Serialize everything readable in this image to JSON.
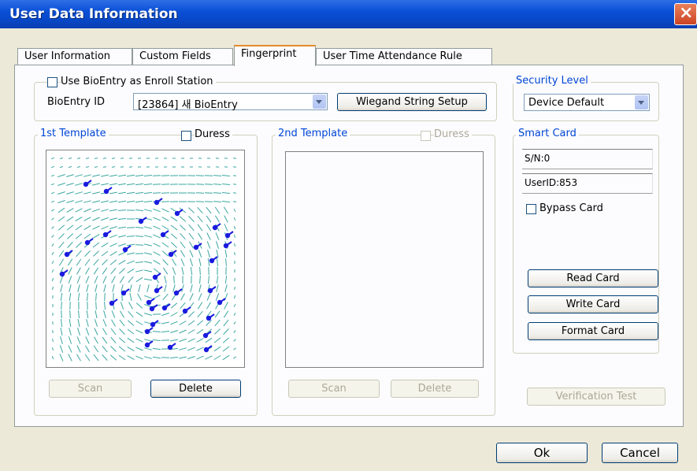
{
  "window": {
    "title": "User Data Information",
    "close_icon": "close-icon"
  },
  "tabs": [
    {
      "label": "User Information"
    },
    {
      "label": "Custom Fields"
    },
    {
      "label": "Fingerprint",
      "active": true
    },
    {
      "label": "User Time Attendance Rule"
    }
  ],
  "enroll": {
    "use_bioentry_label": "Use BioEntry as Enroll Station",
    "use_bioentry_checked": false,
    "bioentry_id_label": "BioEntry ID",
    "bioentry_id_value": "[23864] 새 BioEntry",
    "wiegand_button": "Wiegand String Setup"
  },
  "security": {
    "legend": "Security Level",
    "value": "Device Default"
  },
  "template1": {
    "legend": "1st Template",
    "duress_label": "Duress",
    "duress_checked": false,
    "scan_label": "Scan",
    "delete_label": "Delete"
  },
  "template2": {
    "legend": "2nd Template",
    "duress_label": "Duress",
    "duress_checked": false,
    "scan_label": "Scan",
    "delete_label": "Delete"
  },
  "smart_card": {
    "legend": "Smart Card",
    "serial": "S/N:0",
    "user_id": "UserID:853",
    "bypass_label": "Bypass Card",
    "bypass_checked": false,
    "read_label": "Read Card",
    "write_label": "Write Card",
    "format_label": "Format Card",
    "verify_label": "Verification Test"
  },
  "dialog": {
    "ok_label": "Ok",
    "cancel_label": "Cancel"
  },
  "colors": {
    "title_bar": "#0a4fd6",
    "legend_text": "#0046d5",
    "ridge": "#3aa6a0",
    "minutia": "#1a1adf"
  }
}
